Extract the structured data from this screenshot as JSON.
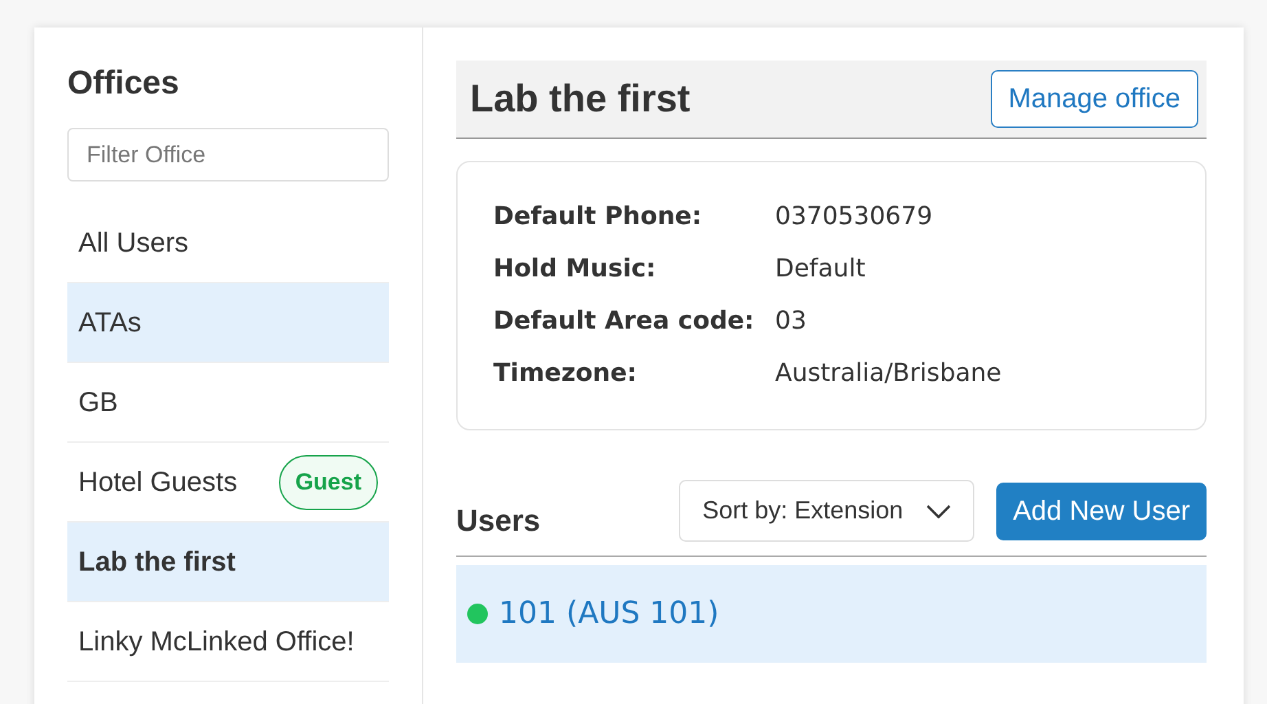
{
  "sidebar": {
    "title": "Offices",
    "filter": {
      "placeholder": "Filter Office"
    },
    "items": [
      {
        "label": "All Users",
        "selected": false,
        "highlighted": false
      },
      {
        "label": "ATAs",
        "selected": false,
        "highlighted": true
      },
      {
        "label": "GB",
        "selected": false,
        "highlighted": false
      },
      {
        "label": "Hotel Guests",
        "selected": false,
        "highlighted": false,
        "badge": "Guest"
      },
      {
        "label": "Lab the first",
        "selected": true,
        "highlighted": true
      },
      {
        "label": "Linky McLinked Office!",
        "selected": false,
        "highlighted": false
      }
    ]
  },
  "office": {
    "title": "Lab the first",
    "manage_button": "Manage office",
    "details": [
      {
        "label": "Default Phone:",
        "value": "0370530679"
      },
      {
        "label": "Hold Music:",
        "value": "Default"
      },
      {
        "label": "Default Area code:",
        "value": "03"
      },
      {
        "label": "Timezone:",
        "value": "Australia/Brisbane"
      }
    ]
  },
  "users": {
    "title": "Users",
    "sort": {
      "value": "Sort by: Extension"
    },
    "add_button": "Add New User",
    "rows": [
      {
        "label": "101 (AUS 101)",
        "color": "#22c55e"
      }
    ]
  }
}
